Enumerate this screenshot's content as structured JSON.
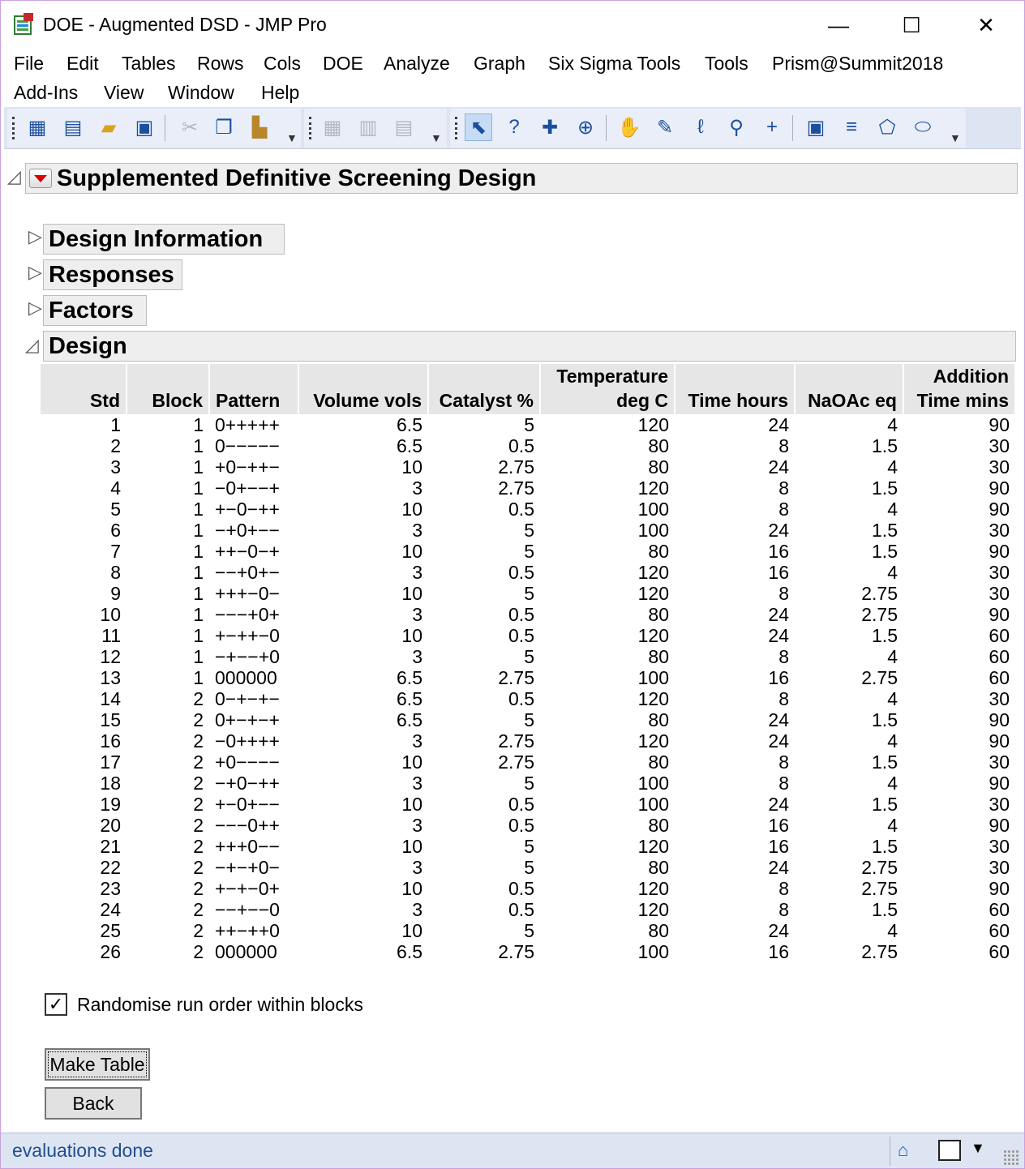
{
  "window": {
    "title": "DOE - Augmented DSD - JMP Pro",
    "minimize": "—",
    "maximize": "☐",
    "close": "✕"
  },
  "menu": {
    "row1": [
      "File",
      "Edit",
      "Tables",
      "Rows",
      "Cols",
      "DOE",
      "Analyze",
      "Graph",
      "Six Sigma Tools",
      "Tools",
      "Prism@Summit2018"
    ],
    "row2": [
      "Add-Ins",
      "View",
      "Window",
      "Help"
    ]
  },
  "toolbar": {
    "icons": [
      "new-data-table-icon",
      "new-script-icon",
      "open-icon",
      "save-icon",
      "cut-icon",
      "copy-icon",
      "paste-icon",
      "data-grid-icon",
      "chart-icon",
      "report-icon",
      "arrow-tool-icon",
      "help-tool-icon",
      "selection-tool-icon",
      "crosshair-icon",
      "grabber-icon",
      "brush-icon",
      "lasso-icon",
      "magnifier-icon",
      "crosshair-plus-icon",
      "annotate-icon",
      "line-icon",
      "polygon-icon",
      "oval-icon"
    ]
  },
  "report": {
    "title": "Supplemented Definitive Screening Design",
    "sections": {
      "design_information": "Design Information",
      "responses": "Responses",
      "factors": "Factors",
      "design": "Design"
    }
  },
  "design_table": {
    "headers": {
      "std": "Std",
      "block": "Block",
      "pattern": "Pattern",
      "volume": "Volume vols",
      "catalyst": "Catalyst %",
      "temperature_l1": "Temperature",
      "temperature_l2": "deg C",
      "time": "Time hours",
      "naoac": "NaOAc eq",
      "addition_l1": "Addition",
      "addition_l2": "Time mins"
    },
    "rows": [
      [
        "1",
        "1",
        "0+++++",
        "6.5",
        "5",
        "120",
        "24",
        "4",
        "90"
      ],
      [
        "2",
        "1",
        "0−−−−−",
        "6.5",
        "0.5",
        "80",
        "8",
        "1.5",
        "30"
      ],
      [
        "3",
        "1",
        "+0−++−",
        "10",
        "2.75",
        "80",
        "24",
        "4",
        "30"
      ],
      [
        "4",
        "1",
        "−0+−−+",
        "3",
        "2.75",
        "120",
        "8",
        "1.5",
        "90"
      ],
      [
        "5",
        "1",
        "+−0−++",
        "10",
        "0.5",
        "100",
        "8",
        "4",
        "90"
      ],
      [
        "6",
        "1",
        "−+0+−−",
        "3",
        "5",
        "100",
        "24",
        "1.5",
        "30"
      ],
      [
        "7",
        "1",
        "++−0−+",
        "10",
        "5",
        "80",
        "16",
        "1.5",
        "90"
      ],
      [
        "8",
        "1",
        "−−+0+−",
        "3",
        "0.5",
        "120",
        "16",
        "4",
        "30"
      ],
      [
        "9",
        "1",
        "+++−0−",
        "10",
        "5",
        "120",
        "8",
        "2.75",
        "30"
      ],
      [
        "10",
        "1",
        "−−−+0+",
        "3",
        "0.5",
        "80",
        "24",
        "2.75",
        "90"
      ],
      [
        "11",
        "1",
        "+−++−0",
        "10",
        "0.5",
        "120",
        "24",
        "1.5",
        "60"
      ],
      [
        "12",
        "1",
        "−+−−+0",
        "3",
        "5",
        "80",
        "8",
        "4",
        "60"
      ],
      [
        "13",
        "1",
        "000000",
        "6.5",
        "2.75",
        "100",
        "16",
        "2.75",
        "60"
      ],
      [
        "14",
        "2",
        "0−+−+−",
        "6.5",
        "0.5",
        "120",
        "8",
        "4",
        "30"
      ],
      [
        "15",
        "2",
        "0+−+−+",
        "6.5",
        "5",
        "80",
        "24",
        "1.5",
        "90"
      ],
      [
        "16",
        "2",
        "−0++++",
        "3",
        "2.75",
        "120",
        "24",
        "4",
        "90"
      ],
      [
        "17",
        "2",
        "+0−−−−",
        "10",
        "2.75",
        "80",
        "8",
        "1.5",
        "30"
      ],
      [
        "18",
        "2",
        "−+0−++",
        "3",
        "5",
        "100",
        "8",
        "4",
        "90"
      ],
      [
        "19",
        "2",
        "+−0+−−",
        "10",
        "0.5",
        "100",
        "24",
        "1.5",
        "30"
      ],
      [
        "20",
        "2",
        "−−−0++",
        "3",
        "0.5",
        "80",
        "16",
        "4",
        "90"
      ],
      [
        "21",
        "2",
        "+++0−−",
        "10",
        "5",
        "120",
        "16",
        "1.5",
        "30"
      ],
      [
        "22",
        "2",
        "−+−+0−",
        "3",
        "5",
        "80",
        "24",
        "2.75",
        "30"
      ],
      [
        "23",
        "2",
        "+−+−0+",
        "10",
        "0.5",
        "120",
        "8",
        "2.75",
        "90"
      ],
      [
        "24",
        "2",
        "−−+−−0",
        "3",
        "0.5",
        "120",
        "8",
        "1.5",
        "60"
      ],
      [
        "25",
        "2",
        "++−++0",
        "10",
        "5",
        "80",
        "24",
        "4",
        "60"
      ],
      [
        "26",
        "2",
        "000000",
        "6.5",
        "2.75",
        "100",
        "16",
        "2.75",
        "60"
      ]
    ]
  },
  "randomise": {
    "label": "Randomise run order within blocks",
    "checked": true,
    "mark": "✓"
  },
  "buttons": {
    "make_table": "Make Table",
    "back": "Back"
  },
  "status": {
    "text": "evaluations done"
  }
}
